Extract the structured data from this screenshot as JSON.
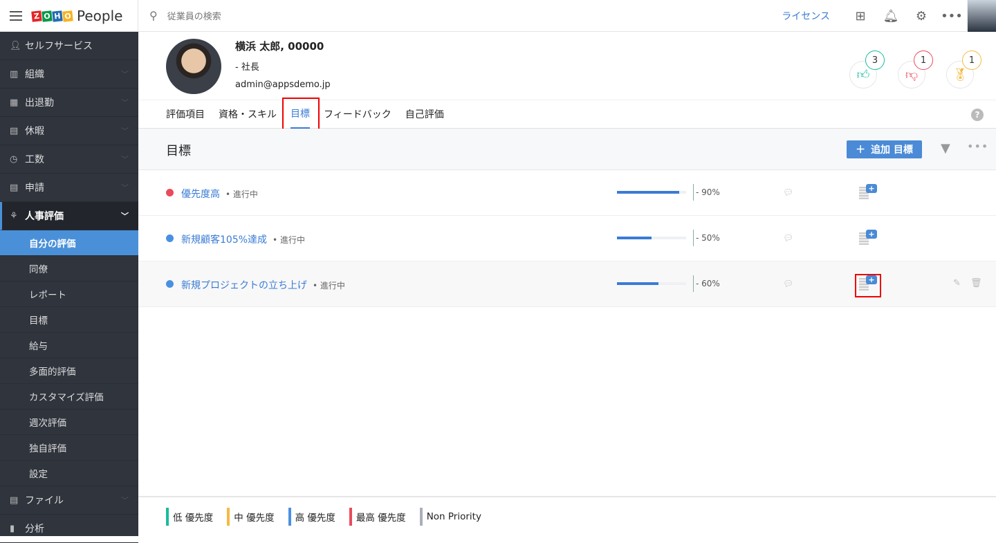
{
  "app": {
    "brand_letters": [
      "Z",
      "O",
      "H",
      "O"
    ],
    "brand_colors": [
      "#e42527",
      "#089949",
      "#226db4",
      "#f9b21d"
    ],
    "product": "People"
  },
  "search": {
    "placeholder": "従業員の検索"
  },
  "topbar": {
    "license": "ライセンス"
  },
  "sidebar": {
    "items": [
      {
        "label": "セルフサービス",
        "icon": "user-icon"
      },
      {
        "label": "組織",
        "icon": "building-icon"
      },
      {
        "label": "出退勤",
        "icon": "calendar-icon"
      },
      {
        "label": "休暇",
        "icon": "leave-icon"
      },
      {
        "label": "工数",
        "icon": "clock-icon"
      },
      {
        "label": "申請",
        "icon": "form-icon"
      },
      {
        "label": "人事評価",
        "icon": "appraisal-icon"
      }
    ],
    "sub_items": [
      "自分の評価",
      "同僚",
      "レポート",
      "目標",
      "給与",
      "多面的評価",
      "カスタマイズ評価",
      "週次評価",
      "独自評価",
      "設定"
    ],
    "after": [
      {
        "label": "ファイル",
        "icon": "file-icon"
      },
      {
        "label": "分析",
        "icon": "analytics-icon"
      }
    ]
  },
  "profile": {
    "name": "横浜 太郎, 00000",
    "title": "- 社長",
    "email": "admin@appsdemo.jp",
    "badges": [
      {
        "type": "like",
        "count": "3",
        "color": "#1abc9c"
      },
      {
        "type": "dislike",
        "count": "1",
        "color": "#e94b5c"
      },
      {
        "type": "award",
        "count": "1",
        "color": "#f5b942"
      }
    ]
  },
  "tabs": [
    "評価項目",
    "資格・スキル",
    "目標",
    "フィードバック",
    "自己評価"
  ],
  "section": {
    "title": "目標",
    "add_label": "追加 目標"
  },
  "goals": [
    {
      "name": "優先度高",
      "status": "進行中",
      "progress": 90,
      "pct": "90%",
      "color": "#e94b5c"
    },
    {
      "name": "新規顧客105%達成",
      "status": "進行中",
      "progress": 50,
      "pct": "50%",
      "color": "#4a90e2"
    },
    {
      "name": "新規プロジェクトの立ち上げ",
      "status": "進行中",
      "progress": 60,
      "pct": "60%",
      "color": "#4a90e2"
    }
  ],
  "legend": [
    {
      "label": "低 優先度",
      "color": "#1abc9c"
    },
    {
      "label": "中 優先度",
      "color": "#f5b942"
    },
    {
      "label": "高 優先度",
      "color": "#4a90e2"
    },
    {
      "label": "最高 優先度",
      "color": "#e94b5c"
    },
    {
      "label": "Non Priority",
      "color": "#aab0ba"
    }
  ]
}
